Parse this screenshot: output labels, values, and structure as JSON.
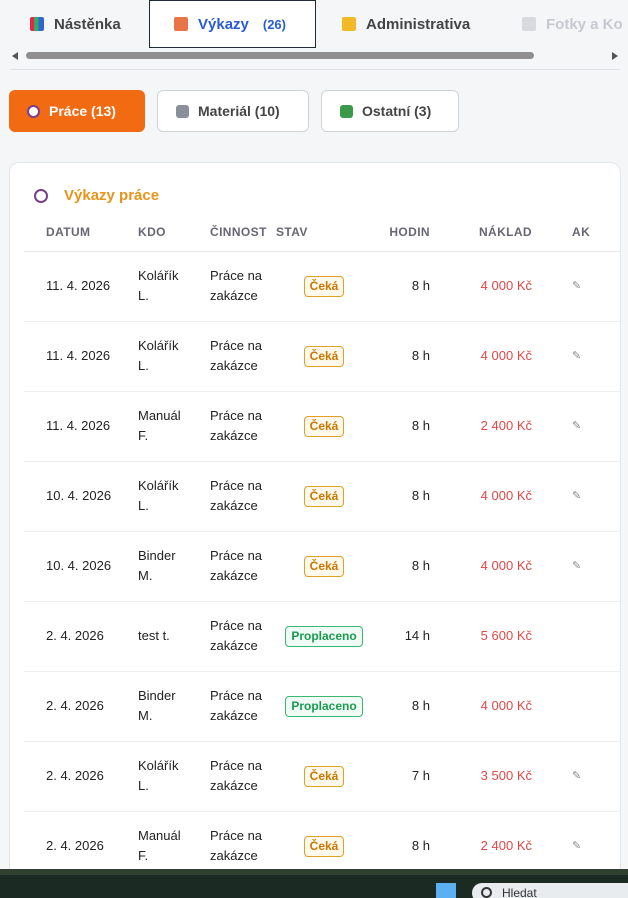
{
  "tabs": [
    {
      "label": "Nástěnka",
      "count": "",
      "icon": "chart-icon"
    },
    {
      "label": "Výkazy",
      "count": "(26)",
      "icon": "report-icon"
    },
    {
      "label": "Administrativa",
      "count": "",
      "icon": "folder-icon"
    },
    {
      "label": "Fotky a Ko",
      "count": "",
      "icon": "camera-icon"
    }
  ],
  "subtabs": {
    "work": "Práce (13)",
    "material": "Materiál (10)",
    "other": "Ostatní (3)"
  },
  "card": {
    "title": "Výkazy práce"
  },
  "table": {
    "headers": [
      "DATUM",
      "KDO",
      "ČINNOST",
      "STAV",
      "HODIN",
      "NÁKLAD",
      "AK"
    ],
    "rows": [
      {
        "date": "11. 4. 2026",
        "who": "Kolářík L.",
        "activity": "Práce na zakázce",
        "status": "Čeká",
        "hours": "8 h",
        "cost": "4 000 Kč",
        "action": "✎"
      },
      {
        "date": "11. 4. 2026",
        "who": "Kolářík L.",
        "activity": "Práce na zakázce",
        "status": "Čeká",
        "hours": "8 h",
        "cost": "4 000 Kč",
        "action": "✎"
      },
      {
        "date": "11. 4. 2026",
        "who": "Manuál F.",
        "activity": "Práce na zakázce",
        "status": "Čeká",
        "hours": "8 h",
        "cost": "2 400 Kč",
        "action": "✎"
      },
      {
        "date": "10. 4. 2026",
        "who": "Kolářík L.",
        "activity": "Práce na zakázce",
        "status": "Čeká",
        "hours": "8 h",
        "cost": "4 000 Kč",
        "action": "✎"
      },
      {
        "date": "10. 4. 2026",
        "who": "Binder M.",
        "activity": "Práce na zakázce",
        "status": "Čeká",
        "hours": "8 h",
        "cost": "4 000 Kč",
        "action": "✎"
      },
      {
        "date": "2. 4. 2026",
        "who": "test t.",
        "activity": "Práce na zakázce",
        "status": "Proplaceno",
        "hours": "14 h",
        "cost": "5 600 Kč",
        "action": ""
      },
      {
        "date": "2. 4. 2026",
        "who": "Binder M.",
        "activity": "Práce na zakázce",
        "status": "Proplaceno",
        "hours": "8 h",
        "cost": "4 000 Kč",
        "action": ""
      },
      {
        "date": "2. 4. 2026",
        "who": "Kolářík L.",
        "activity": "Práce na zakázce",
        "status": "Čeká",
        "hours": "7 h",
        "cost": "3 500 Kč",
        "action": "✎"
      },
      {
        "date": "2. 4. 2026",
        "who": "Manuál F.",
        "activity": "Práce na zakázce",
        "status": "Čeká",
        "hours": "8 h",
        "cost": "2 400 Kč",
        "action": "✎"
      }
    ]
  },
  "taskbar": {
    "search_placeholder": "Hledat"
  },
  "colors": {
    "accent": "#f26a12",
    "active_tab": "#2a5bd7",
    "cost": "#e04848",
    "pending": "#c77800",
    "paid": "#1a9a52"
  }
}
